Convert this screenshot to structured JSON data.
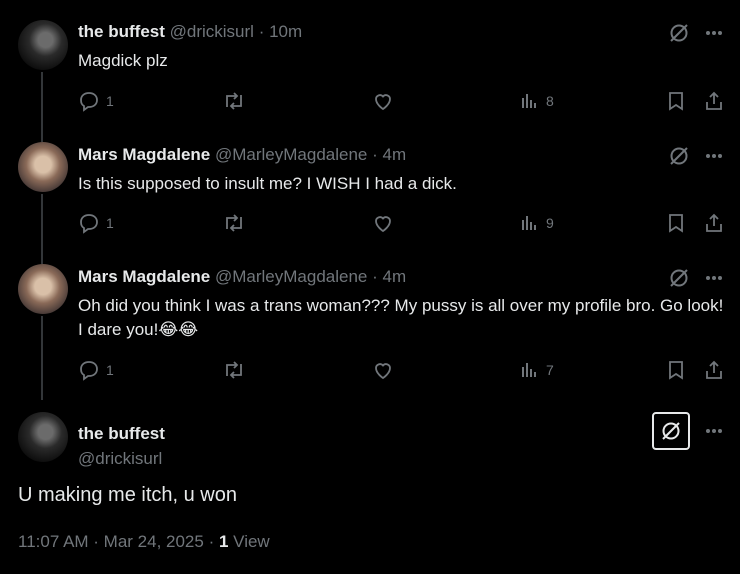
{
  "replies": [
    {
      "name": "the buffest",
      "handle": "@drickisurl",
      "time": "10m",
      "text": "Magdick plz",
      "stats": {
        "replies": "1",
        "retweets": "",
        "likes": "",
        "views": "8"
      }
    },
    {
      "name": "Mars Magdalene",
      "handle": "@MarleyMagdalene",
      "time": "4m",
      "text": "Is this supposed to insult me? I WISH I had a dick.",
      "stats": {
        "replies": "1",
        "retweets": "",
        "likes": "",
        "views": "9"
      }
    },
    {
      "name": "Mars Magdalene",
      "handle": "@MarleyMagdalene",
      "time": "4m",
      "text": "Oh did you think I was a trans woman??? My pussy is all over my profile bro. Go look! I dare you!😂😂",
      "stats": {
        "replies": "1",
        "retweets": "",
        "likes": "",
        "views": "7"
      }
    }
  ],
  "main": {
    "name": "the buffest",
    "handle": "@drickisurl",
    "text": "U making me itch, u won",
    "timestamp": "11:07 AM · Mar 24, 2025 · ",
    "views_count": "1",
    "views_label": " View"
  },
  "separator": "·",
  "colors": {
    "background": "#000000",
    "text": "#e7e9ea",
    "muted": "#71767b"
  }
}
